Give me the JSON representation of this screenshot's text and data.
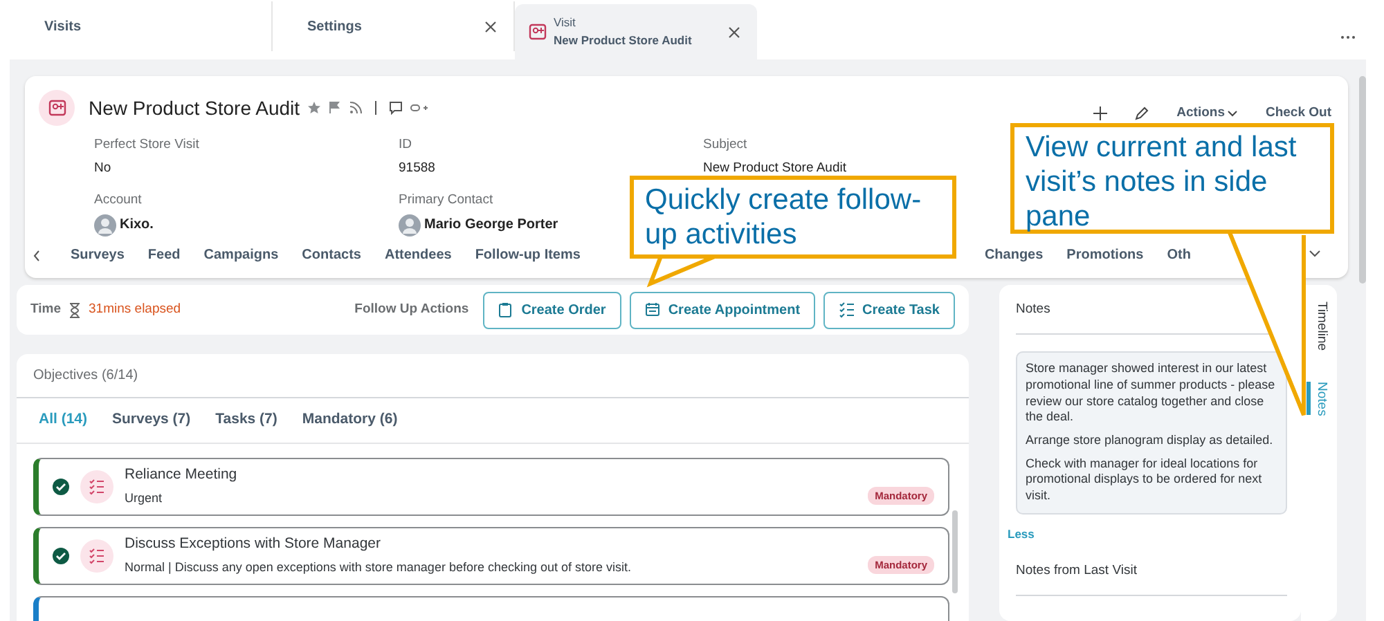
{
  "app_tabs": [
    {
      "label": "Visits",
      "selected": false,
      "closable": false
    },
    {
      "label": "Settings",
      "selected": false,
      "closable": true
    },
    {
      "caption": "Visit",
      "label": "New Product Store Audit",
      "selected": true,
      "closable": true
    }
  ],
  "header": {
    "title": "New Product Store Audit",
    "actions": [
      "Actions",
      "Check Out"
    ],
    "fields": [
      {
        "label": "Perfect Store Visit",
        "value": "No",
        "avatar": false
      },
      {
        "label": "ID",
        "value": "91588",
        "avatar": false
      },
      {
        "label": "Subject",
        "value": "New Product Store Audit",
        "avatar": false
      },
      {
        "label": "Account",
        "value": "Kixo.",
        "avatar": true
      },
      {
        "label": "Primary Contact",
        "value": "Mario George Porter",
        "avatar": true
      }
    ]
  },
  "section_tabs": [
    "Surveys",
    "Feed",
    "Campaigns",
    "Contacts",
    "Attendees",
    "Follow-up Items",
    "Changes",
    "Promotions",
    "Oth"
  ],
  "time": {
    "label": "Time",
    "value": "31mins elapsed"
  },
  "follow_up": {
    "label": "Follow Up Actions",
    "buttons": [
      "Create Order",
      "Create Appointment",
      "Create Task"
    ]
  },
  "objectives": {
    "title": "Objectives (6/14)",
    "filters": [
      {
        "label": "All (14)",
        "selected": true
      },
      {
        "label": "Surveys (7)",
        "selected": false
      },
      {
        "label": "Tasks (7)",
        "selected": false
      },
      {
        "label": "Mandatory (6)",
        "selected": false
      }
    ],
    "items": [
      {
        "title": "Reliance Meeting",
        "subtitle": "Urgent",
        "badge": "Mandatory",
        "done": true
      },
      {
        "title": "Discuss Exceptions with Store Manager",
        "subtitle": "Normal | Discuss any open exceptions with store manager before checking out of store visit.",
        "badge": "Mandatory",
        "done": true
      },
      {
        "done": false
      }
    ]
  },
  "notes": {
    "title": "Notes",
    "paragraphs": [
      "Store manager showed interest in our latest promotional line of summer products - please review our store catalog together and close the deal.",
      "Arrange store planogram display as detailed.",
      "Check with manager for ideal locations for promotional displays to be ordered for next visit."
    ],
    "toggle": "Less",
    "last_visit_title": "Notes from Last Visit"
  },
  "side_tabs": [
    {
      "label": "Timeline",
      "selected": false
    },
    {
      "label": "Notes",
      "selected": true
    }
  ],
  "callouts": [
    "Quickly create follow-up activities",
    "View current and last visit’s notes in side pane"
  ]
}
